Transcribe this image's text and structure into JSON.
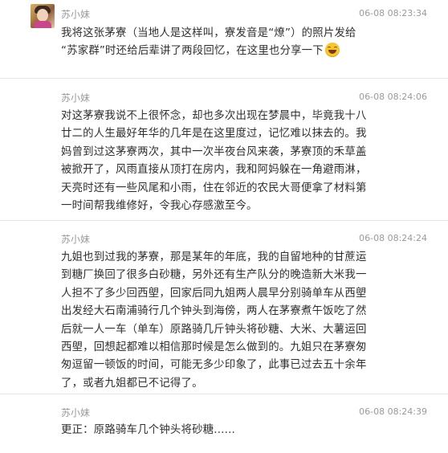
{
  "messages": [
    {
      "author": "苏小妹",
      "time": "06-08 08:23:34",
      "lines": [
        "我将这张茅寮（当地人是这样叫，寮发音是“燎”）的照片发给",
        "“苏家群”时还给后辈讲了两段回忆，在这里也分享一下"
      ],
      "emoji": "grinning-face-emoji"
    },
    {
      "author": "苏小妹",
      "time": "06-08 08:24:06",
      "lines": [
        "对这茅寮我说不上很怀念，却也多次出现在梦晨中，毕竟我十八",
        "廿二的人生最好年华的几年是在这里度过，记忆难以抹去的。我",
        "妈曾到过这茅寮两次，其中一次半夜台风来袭，茅寮顶的禾草盖",
        "被掀开了，风雨直接从顶打在房内，我和阿妈躲在一角避雨淋，",
        "天亮时还有一些风尾和小雨，住在邻近的农民大哥便拿了材料第",
        "一时间帮我维修好，令我心存感激至今。"
      ]
    },
    {
      "author": "苏小妹",
      "time": "06-08 08:24:24",
      "lines": [
        "九姐也到过我的茅寮，那是某年的年底，我的自留地种的甘蔗运",
        "到糖厂换回了很多白砂糖，另外还有生产队分的晚造新大米我一",
        "人担不了多少回西塱，回家后同九姐两人晨早分别骑单车从西塱",
        "出发经大石南浦骑行几个钟头到海傍，两人在茅寮煮午饭吃了然",
        "后就一人一车（单车）原路骑几斤钟头将砂糖、大米、大薯运回",
        "西塱，回想起都难以相信那时候是怎么做到的。九姐只在茅寮匆",
        "匆逗留一顿饭的时间，可能无多少印象了，此事已过去五十余年",
        "了，或者九姐都已不记得了。"
      ]
    },
    {
      "author": "苏小妹",
      "time": "06-08 08:24:39",
      "lines": [
        "更正：原路骑车几个钟头将砂糖......"
      ]
    }
  ]
}
